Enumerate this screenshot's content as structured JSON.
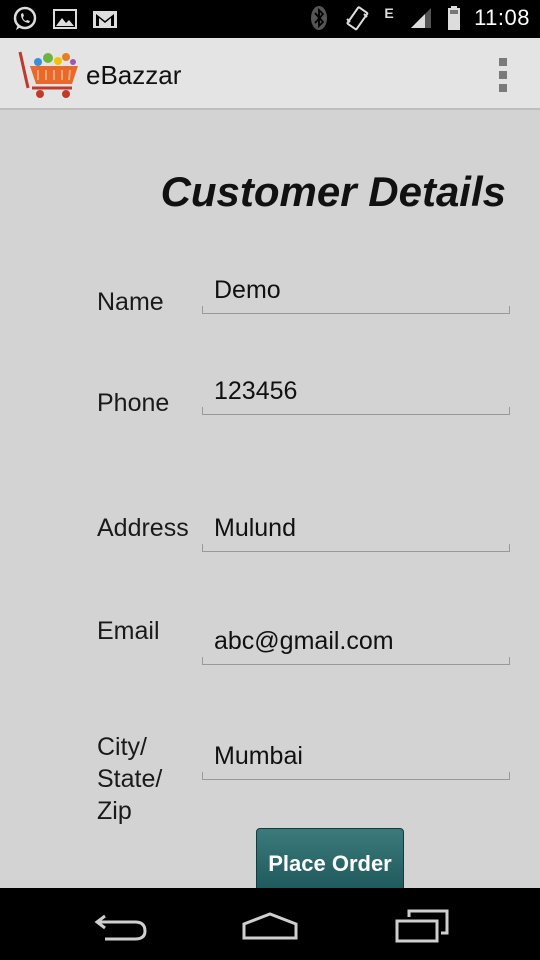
{
  "status_bar": {
    "time": "11:08",
    "network_type": "E",
    "left_icons": [
      "whatsapp-icon",
      "image-icon",
      "gmail-icon"
    ],
    "right_icons": [
      "bluetooth-icon",
      "vibrate-icon",
      "signal-icon",
      "battery-icon"
    ]
  },
  "app_bar": {
    "title": "eBazzar",
    "menu_icon": "overflow-menu-icon"
  },
  "form": {
    "heading": "Customer Details",
    "name_label": "Name",
    "name_value": "Demo",
    "phone_label": "Phone",
    "phone_value": "123456",
    "address_label": "Address",
    "address_value": "Mulund",
    "email_label": "Email",
    "email_value": "abc@gmail.com",
    "city_label_line1": "City/",
    "city_label_line2": "State/",
    "city_label_line3": "Zip",
    "city_value": "Mumbai",
    "submit_label": "Place Order"
  },
  "nav_bar": {
    "icons": [
      "back-icon",
      "home-icon",
      "recent-apps-icon"
    ]
  }
}
